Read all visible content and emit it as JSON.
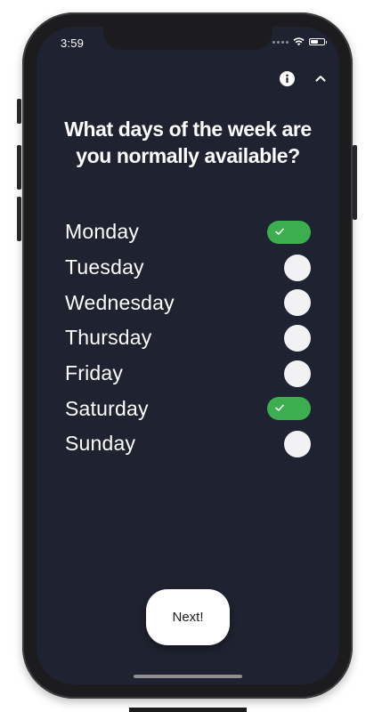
{
  "status_bar": {
    "time": "3:59",
    "icons": [
      "signal-dots-icon",
      "wifi-icon",
      "battery-icon"
    ],
    "battery_level": 0.55
  },
  "header_actions": {
    "info_icon": "info-icon",
    "collapse_icon": "chevron-up-icon"
  },
  "question": "What days of the week are you normally available?",
  "days": [
    {
      "label": "Monday",
      "selected": true
    },
    {
      "label": "Tuesday",
      "selected": false
    },
    {
      "label": "Wednesday",
      "selected": false
    },
    {
      "label": "Thursday",
      "selected": false
    },
    {
      "label": "Friday",
      "selected": false
    },
    {
      "label": "Saturday",
      "selected": true
    },
    {
      "label": "Sunday",
      "selected": false
    }
  ],
  "next_button": "Next!",
  "colors": {
    "background": "#1f2230",
    "toggle_on": "#3dae4f",
    "toggle_off_knob": "#f2f2f4",
    "text": "#ffffff"
  }
}
